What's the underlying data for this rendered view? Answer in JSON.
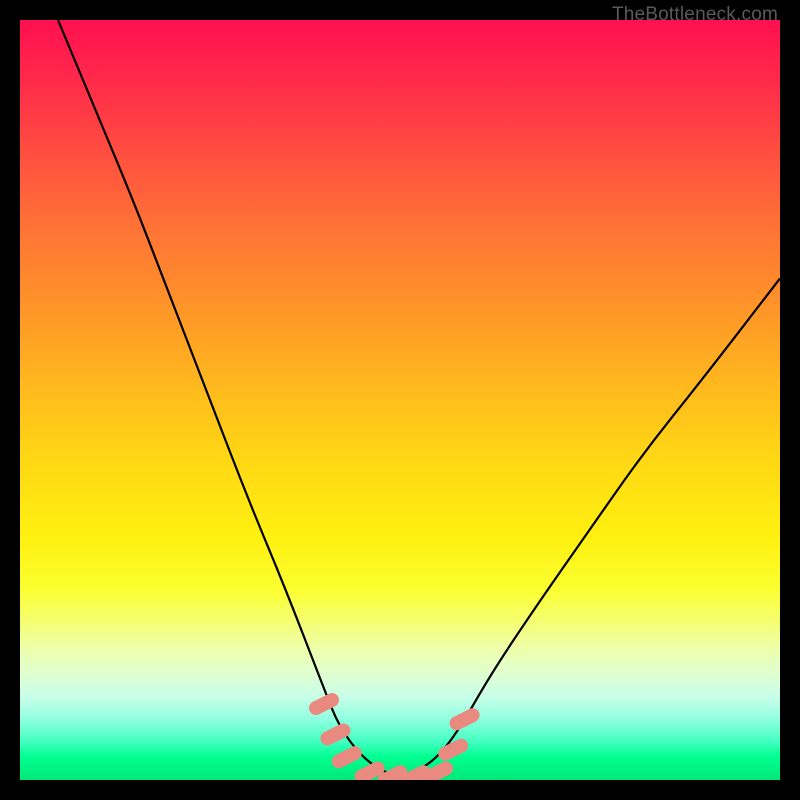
{
  "watermark": "TheBottleneck.com",
  "chart_data": {
    "type": "line",
    "title": "",
    "xlabel": "",
    "ylabel": "",
    "xlim": [
      0,
      100
    ],
    "ylim": [
      0,
      100
    ],
    "series": [
      {
        "name": "bottleneck-curve",
        "x": [
          5,
          10,
          15,
          20,
          25,
          30,
          35,
          40,
          42,
          45,
          48,
          50,
          52,
          55,
          58,
          62,
          68,
          75,
          82,
          90,
          100
        ],
        "values": [
          100,
          88,
          76,
          63,
          50,
          37,
          25,
          12,
          7,
          3,
          1,
          0.5,
          1,
          3,
          7,
          14,
          23,
          33,
          43,
          53,
          66
        ]
      }
    ],
    "markers": [
      {
        "x": 40.0,
        "y": 10,
        "color": "#e88a80"
      },
      {
        "x": 41.5,
        "y": 6,
        "color": "#e88a80"
      },
      {
        "x": 43.0,
        "y": 3,
        "color": "#e88a80"
      },
      {
        "x": 46.0,
        "y": 1,
        "color": "#e88a80"
      },
      {
        "x": 49.0,
        "y": 0.5,
        "color": "#e88a80"
      },
      {
        "x": 52.0,
        "y": 0.5,
        "color": "#e88a80"
      },
      {
        "x": 55.0,
        "y": 1,
        "color": "#e88a80"
      },
      {
        "x": 57.0,
        "y": 4,
        "color": "#e88a80"
      },
      {
        "x": 58.5,
        "y": 8,
        "color": "#e88a80"
      }
    ],
    "background_gradient": {
      "top_color": "#ff1050",
      "mid_color": "#fff010",
      "bottom_color": "#00e878"
    }
  }
}
